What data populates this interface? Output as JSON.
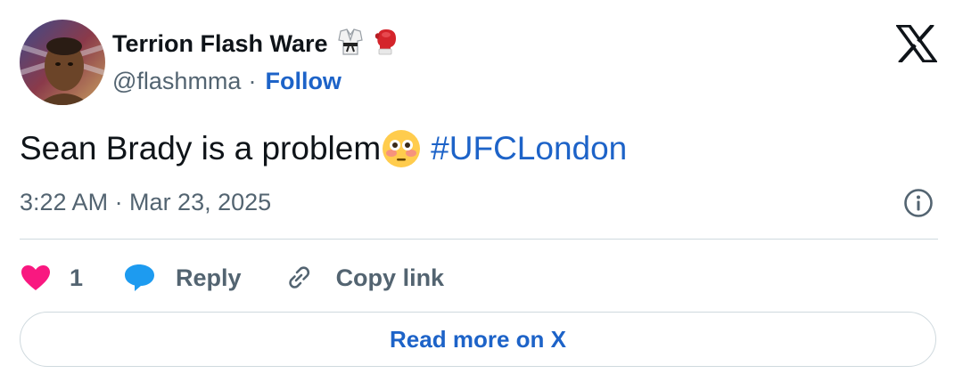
{
  "author": {
    "name": "Terrion Flash Ware",
    "handle": "@flashmma",
    "separator": "·",
    "follow_label": "Follow",
    "badge_icons": [
      "martial-arts-uniform-icon",
      "boxing-glove-icon"
    ]
  },
  "tweet": {
    "text": "Sean Brady is a problem",
    "emoji": "flushed-face-icon",
    "hashtag": "#UFCLondon",
    "timestamp": "3:22 AM · Mar 23, 2025"
  },
  "actions": {
    "like_count": "1",
    "reply_label": "Reply",
    "copy_link_label": "Copy link"
  },
  "read_more_label": "Read more on X",
  "colors": {
    "link_blue": "#1d63c8",
    "heart_pink": "#f91880",
    "reply_blue": "#1d9bf0",
    "text": "#0f1419",
    "muted": "#536471",
    "border": "#cfd9de"
  }
}
